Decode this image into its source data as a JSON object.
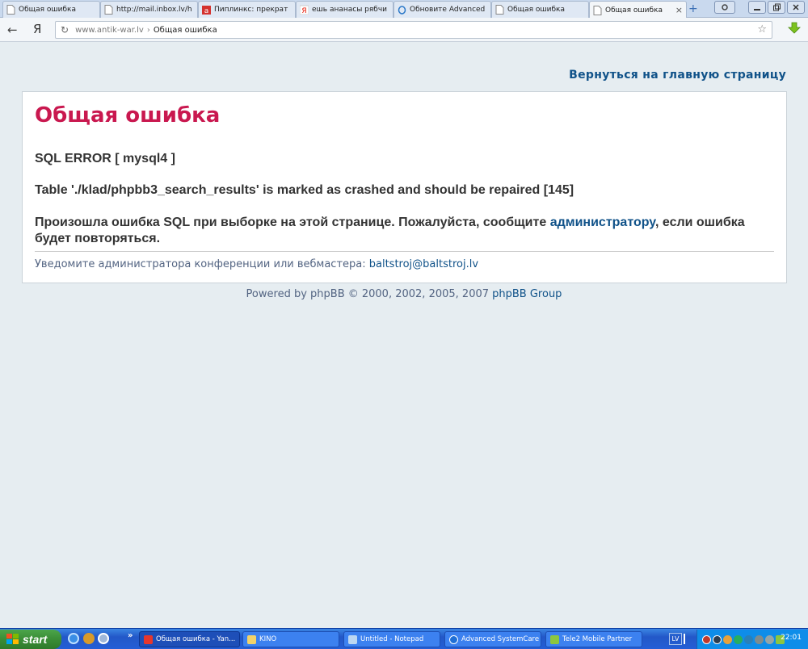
{
  "browser": {
    "tabs": [
      {
        "title": "Общая ошибка",
        "icon": "page-icon"
      },
      {
        "title": "http://mail.inbox.lv/h",
        "icon": "page-icon"
      },
      {
        "title": "Пиплинкс: прекрат",
        "icon": "a-icon"
      },
      {
        "title": "ешь ананасы рябчи",
        "icon": "yandex-icon"
      },
      {
        "title": "Обновите Advanced",
        "icon": "opera-icon"
      },
      {
        "title": "Общая ошибка",
        "icon": "page-icon"
      },
      {
        "title": "Общая ошибка",
        "icon": "page-icon",
        "active": true
      }
    ],
    "new_tab": "+",
    "close_tab": "×",
    "url_host": "www.antik-war.lv",
    "url_sep": "›",
    "page_title": "Общая ошибка",
    "back_glyph": "←",
    "ya_glyph": "Я"
  },
  "page": {
    "return_link": "Вернуться на главную страницу",
    "title": "Общая ошибка",
    "sql_error": "SQL ERROR [ mysql4 ]",
    "table_error": "Table './klad/phpbb3_search_results' is marked as crashed and should be repaired [145]",
    "message_before": "Произошла ошибка SQL при выборке на этой странице. Пожалуйста, сообщите ",
    "message_link": "администратору",
    "message_after": ", если ошибка будет повторяться.",
    "notify_text": "Уведомите администратора конференции или вебмастера: ",
    "notify_email": "baltstroj@baltstroj.lv",
    "powered_text": "Powered by phpBB © 2000, 2002, 2005, 2007 ",
    "powered_link": "phpBB Group"
  },
  "taskbar": {
    "start": "start",
    "quick_more": "»",
    "buttons": [
      {
        "label": "Общая ошибка - Yan...",
        "icon": "yandex-browser-icon",
        "active": true
      },
      {
        "label": "KINO",
        "icon": "folder-icon"
      },
      {
        "label": "Untitled - Notepad",
        "icon": "notepad-icon"
      },
      {
        "label": "Advanced SystemCare",
        "icon": "systemcare-icon"
      },
      {
        "label": "Tele2 Mobile Partner",
        "icon": "tele2-icon"
      }
    ],
    "lang": "LV",
    "clock": "22:01"
  },
  "colors": {
    "title_red": "#c9184f",
    "link_blue": "#105289",
    "muted_blue": "#536482",
    "page_bg": "#e6edf1"
  }
}
